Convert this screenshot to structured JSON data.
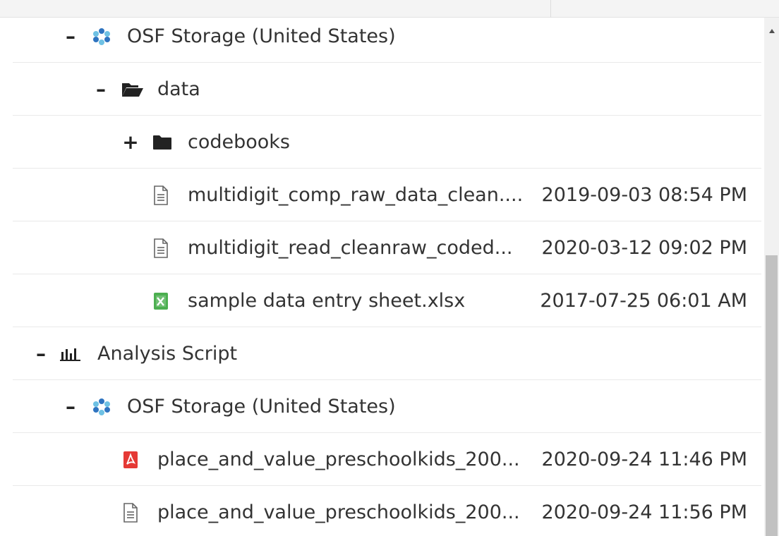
{
  "rows": [
    {
      "toggle": "–",
      "icon": "osf-storage-icon",
      "label": "OSF Storage (United States)",
      "date": ""
    },
    {
      "toggle": "–",
      "icon": "folder-open-icon",
      "label": "data",
      "date": ""
    },
    {
      "toggle": "+",
      "icon": "folder-icon",
      "label": "codebooks",
      "date": ""
    },
    {
      "toggle": "",
      "icon": "file-text-icon",
      "label": "multidigit_comp_raw_data_clean....",
      "date": "2019-09-03 08:54 PM"
    },
    {
      "toggle": "",
      "icon": "file-text-icon",
      "label": "multidigit_read_cleanraw_coded...",
      "date": "2020-03-12 09:02 PM"
    },
    {
      "toggle": "",
      "icon": "file-excel-icon",
      "label": "sample data entry sheet.xlsx",
      "date": "2017-07-25 06:01 AM"
    },
    {
      "toggle": "–",
      "icon": "analysis-chart-icon",
      "label": "Analysis Script",
      "date": ""
    },
    {
      "toggle": "–",
      "icon": "osf-storage-icon",
      "label": "OSF Storage (United States)",
      "date": ""
    },
    {
      "toggle": "",
      "icon": "file-pdf-icon",
      "label": "place_and_value_preschoolkids_200...",
      "date": "2020-09-24 11:46 PM"
    },
    {
      "toggle": "",
      "icon": "file-text-icon",
      "label": "place_and_value_preschoolkids_200...",
      "date": "2020-09-24 11:56 PM"
    }
  ],
  "colors": {
    "excel_green": "#4caf50",
    "pdf_red": "#e53935",
    "osf_blue": "#2f74c0",
    "osf_cyan": "#6ec1e4"
  }
}
